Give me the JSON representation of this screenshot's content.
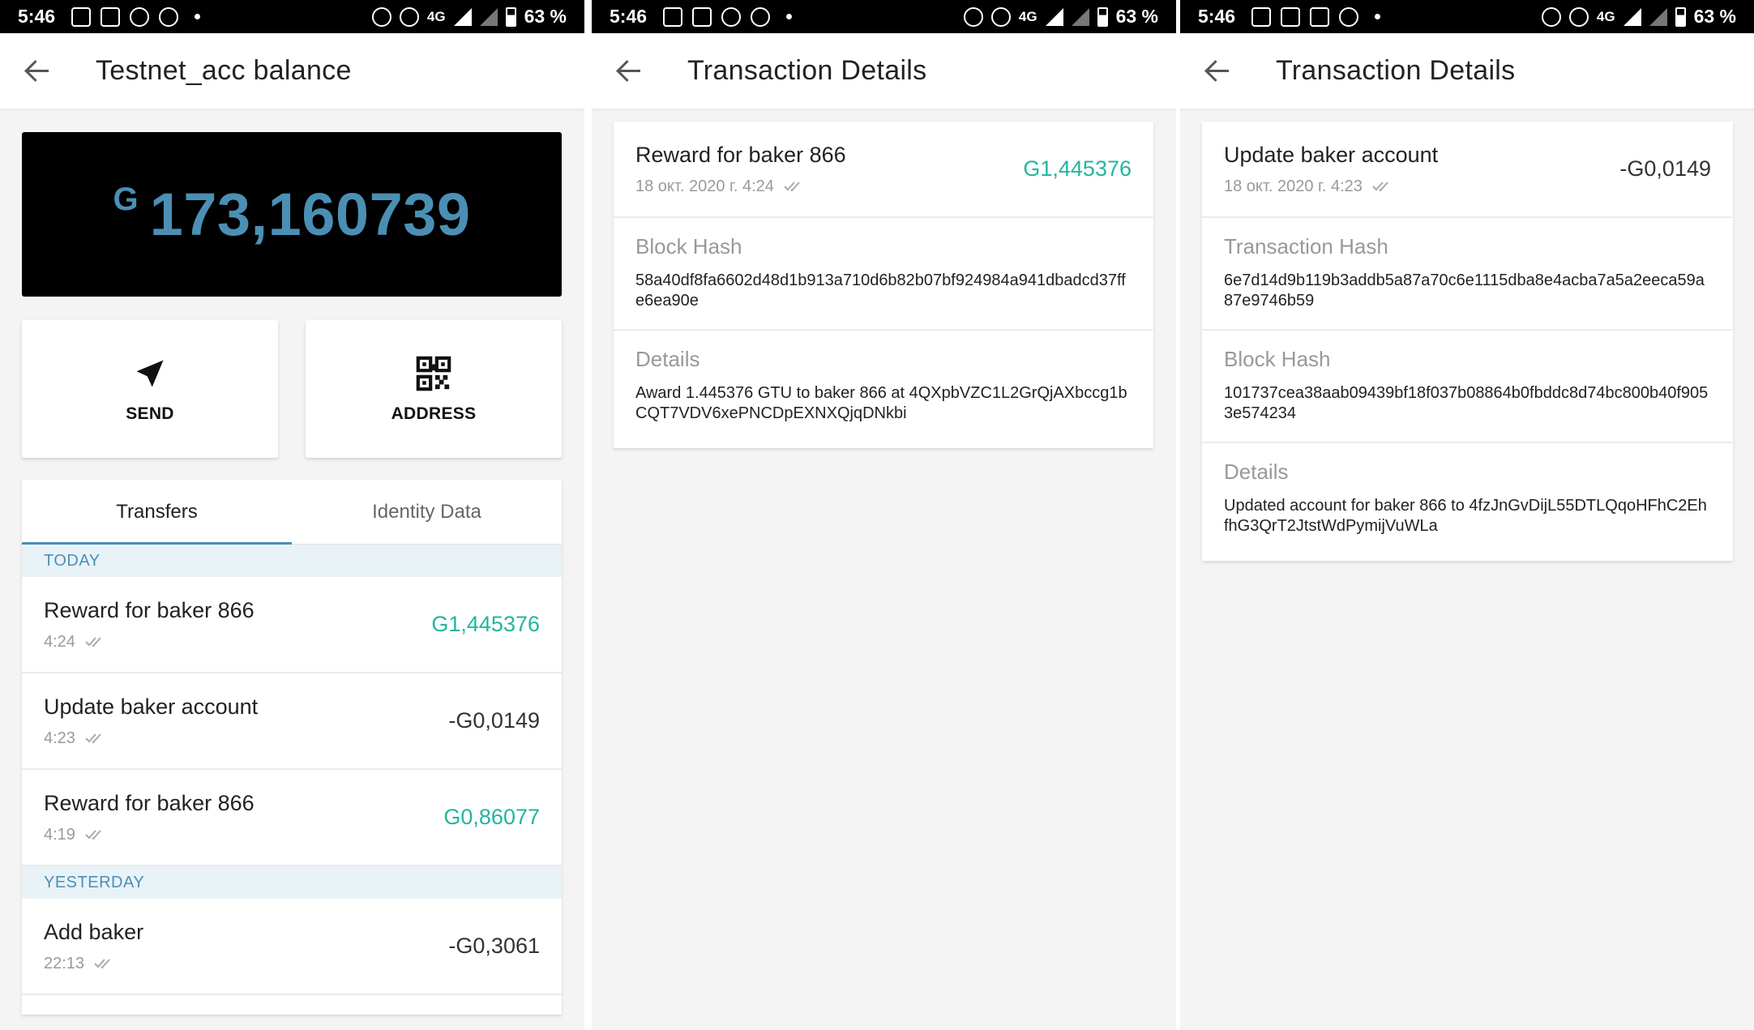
{
  "status_bar": {
    "time": "5:46",
    "network": "4G",
    "battery": "63 %"
  },
  "panel1": {
    "title": "Testnet_acc balance",
    "balance": {
      "currency": "G",
      "value": "173,160739"
    },
    "actions": {
      "send": "SEND",
      "address": "ADDRESS"
    },
    "tabs": [
      "Transfers",
      "Identity Data"
    ],
    "sections": {
      "today": "TODAY",
      "yesterday": "YESTERDAY"
    },
    "today_tx": [
      {
        "title": "Reward for baker 866",
        "time": "4:24",
        "amount": "G1,445376",
        "positive": true
      },
      {
        "title": "Update baker account",
        "time": "4:23",
        "amount": "-G0,0149",
        "positive": false
      },
      {
        "title": "Reward for baker 866",
        "time": "4:19",
        "amount": "G0,86077",
        "positive": true
      }
    ],
    "yesterday_tx": [
      {
        "title": "Add baker",
        "time": "22:13",
        "amount": "-G0,3061",
        "positive": false
      }
    ]
  },
  "panel2": {
    "title": "Transaction Details",
    "header": {
      "title": "Reward for baker 866",
      "date": "18 окт. 2020 г. 4:24",
      "amount": "G1,445376"
    },
    "block_hash": {
      "label": "Block Hash",
      "value": "58a40df8fa6602d48d1b913a710d6b82b07bf924984a941dbadcd37ffe6ea90e"
    },
    "details": {
      "label": "Details",
      "value": "Award 1.445376 GTU to baker 866 at 4QXpbVZC1L2GrQjAXbccg1bCQT7VDV6xePNCDpEXNXQjqDNkbi"
    }
  },
  "panel3": {
    "title": "Transaction Details",
    "header": {
      "title": "Update baker account",
      "date": "18 окт. 2020 г. 4:23",
      "amount": "-G0,0149"
    },
    "transaction_hash": {
      "label": "Transaction Hash",
      "value": "6e7d14d9b119b3addb5a87a70c6e1115dba8e4acba7a5a2eeca59a87e9746b59"
    },
    "block_hash": {
      "label": "Block Hash",
      "value": "101737cea38aab09439bf18f037b08864b0fbddc8d74bc800b40f9053e574234"
    },
    "details": {
      "label": "Details",
      "value": "Updated account for baker 866 to 4fzJnGvDijL55DTLQqoHFhC2EhfhG3QrT2JtstWdPymijVuWLa"
    }
  },
  "colors": {
    "accent": "#4b8fb5",
    "positive": "#22b5a0",
    "background": "#f4f4f4"
  }
}
